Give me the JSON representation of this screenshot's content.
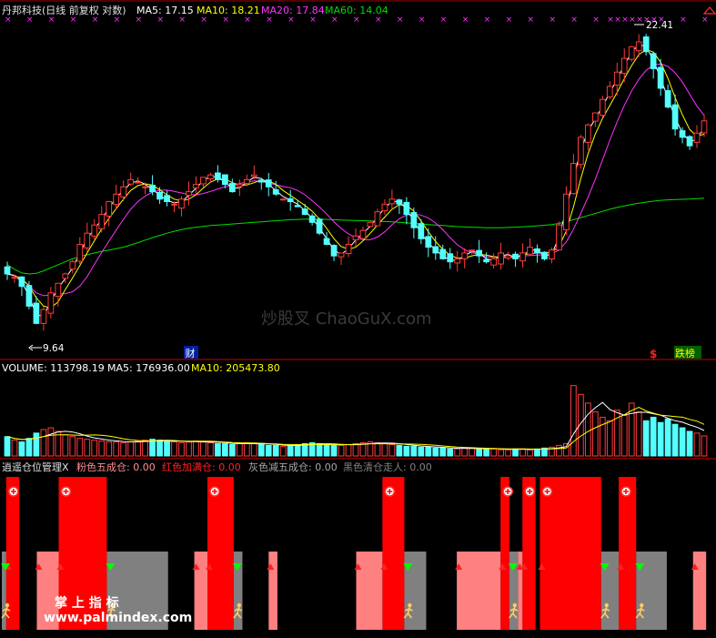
{
  "header": {
    "stock_title": "丹邦科技(日线 前复权 对数)",
    "ma5_label": "MA5: 17.15",
    "ma10_label": "MA10: 18.21",
    "ma20_label": "MA20: 17.84",
    "ma60_label": "MA60: 14.04"
  },
  "price_panel": {
    "high_marker": "22.41",
    "low_marker": "9.64",
    "cai_badge": "财",
    "dollar_badge": "$",
    "dieban_badge": "跌榜",
    "watermark": "炒股叉 ChaoGuX.com"
  },
  "volume_header": {
    "volume_label": "VOLUME: 113798.19",
    "ma5_label": "MA5: 176936.00",
    "ma10_label": "MA10: 205473.80"
  },
  "indicator_header": {
    "name": "逍遥仓位管理X",
    "pink": "粉色五成仓: 0.00",
    "red": "红色加满仓: 0.00",
    "gray": "灰色减五成仓: 0.00",
    "black": "黑色清仓走人: 0.00"
  },
  "footer": {
    "brand_cn": "掌 上 指 标",
    "brand_url": "www.palmindex.com"
  },
  "colors": {
    "up": "#ff3b3b",
    "down": "#54ffff",
    "ma5": "#ffffff",
    "ma10": "#ffff00",
    "ma20": "#ff33ff",
    "ma60": "#00dd00",
    "red_band": "#ff0000",
    "pink_band": "#ff8080",
    "gray_band": "#808080"
  },
  "chart_data": {
    "type": "candlestick",
    "price_scale": "log",
    "ylim": [
      9.2,
      23.6
    ],
    "highest": 22.41,
    "lowest": 9.64,
    "closes": [
      11.6,
      11.5,
      11.2,
      10.6,
      10.1,
      10.5,
      11.0,
      11.3,
      11.6,
      12.0,
      12.6,
      13.0,
      13.3,
      13.7,
      14.2,
      14.5,
      14.8,
      15.1,
      15.0,
      14.8,
      14.6,
      14.3,
      14.2,
      14.1,
      14.3,
      14.6,
      14.9,
      15.2,
      15.3,
      15.1,
      14.9,
      14.6,
      14.9,
      15.1,
      15.3,
      15.0,
      14.8,
      14.5,
      14.3,
      14.2,
      14.0,
      13.7,
      13.4,
      13.0,
      12.6,
      12.2,
      12.3,
      12.6,
      12.9,
      13.1,
      13.4,
      13.8,
      14.1,
      14.3,
      14.1,
      13.7,
      13.2,
      12.8,
      12.5,
      12.3,
      12.1,
      12.0,
      12.1,
      12.3,
      12.4,
      12.2,
      12.0,
      12.1,
      12.3,
      12.2,
      12.1,
      12.3,
      12.5,
      12.3,
      12.1,
      12.4,
      13.3,
      14.5,
      15.8,
      17.0,
      17.6,
      18.2,
      18.9,
      19.6,
      20.4,
      21.2,
      21.9,
      22.2,
      21.6,
      20.6,
      19.5,
      18.5,
      17.4,
      17.0,
      16.6,
      17.2,
      17.8
    ],
    "ma60": [
      11.9,
      11.75,
      11.63,
      11.6,
      11.62,
      11.7,
      11.8,
      11.9,
      12.0,
      12.1,
      12.18,
      12.24,
      12.3,
      12.35,
      12.4,
      12.45,
      12.5,
      12.58,
      12.66,
      12.75,
      12.84,
      12.92,
      13.0,
      13.07,
      13.13,
      13.18,
      13.22,
      13.25,
      13.28,
      13.3,
      13.32,
      13.34,
      13.36,
      13.38,
      13.4,
      13.42,
      13.44,
      13.46,
      13.48,
      13.5,
      13.51,
      13.52,
      13.52,
      13.52,
      13.51,
      13.5,
      13.49,
      13.48,
      13.47,
      13.46,
      13.45,
      13.44,
      13.43,
      13.42,
      13.4,
      13.38,
      13.36,
      13.34,
      13.32,
      13.3,
      13.28,
      13.26,
      13.24,
      13.23,
      13.22,
      13.21,
      13.2,
      13.2,
      13.2,
      13.21,
      13.22,
      13.23,
      13.25,
      13.27,
      13.29,
      13.32,
      13.36,
      13.42,
      13.5,
      13.58,
      13.66,
      13.74,
      13.82,
      13.9,
      13.97,
      14.03,
      14.09,
      14.14,
      14.18,
      14.22,
      14.25,
      14.27,
      14.28,
      14.29,
      14.3,
      14.32,
      14.34
    ],
    "volume_ylim": [
      0,
      460000
    ],
    "volumes": [
      110,
      90,
      80,
      100,
      130,
      150,
      160,
      140,
      120,
      110,
      100,
      95,
      90,
      85,
      80,
      80,
      75,
      80,
      85,
      90,
      95,
      90,
      85,
      80,
      75,
      80,
      85,
      80,
      75,
      70,
      70,
      65,
      70,
      75,
      70,
      65,
      60,
      60,
      55,
      60,
      65,
      70,
      75,
      70,
      65,
      60,
      60,
      65,
      70,
      75,
      80,
      75,
      70,
      65,
      60,
      55,
      55,
      50,
      50,
      45,
      45,
      40,
      40,
      45,
      45,
      40,
      40,
      40,
      35,
      35,
      40,
      40,
      35,
      40,
      45,
      50,
      60,
      70,
      400,
      350,
      300,
      250,
      220,
      200,
      260,
      230,
      300,
      250,
      200,
      220,
      190,
      210,
      180,
      160,
      140,
      130,
      114
    ],
    "volume_unit": "x1000",
    "indicator_bands": [
      {
        "color": "red",
        "from": 1,
        "to": 4
      },
      {
        "color": "red",
        "from": 13,
        "to": 24
      },
      {
        "color": "red",
        "from": 47,
        "to": 53
      },
      {
        "color": "red",
        "from": 87,
        "to": 92
      },
      {
        "color": "red",
        "from": 114,
        "to": 116
      },
      {
        "color": "red",
        "from": 119,
        "to": 122
      },
      {
        "color": "red",
        "from": 123,
        "to": 137
      },
      {
        "color": "red",
        "from": 141,
        "to": 145
      },
      {
        "color": "pink",
        "from": 8,
        "to": 13
      },
      {
        "color": "pink",
        "from": 44,
        "to": 47
      },
      {
        "color": "pink",
        "from": 61,
        "to": 63
      },
      {
        "color": "pink",
        "from": 81,
        "to": 87
      },
      {
        "color": "pink",
        "from": 104,
        "to": 114
      },
      {
        "color": "pink",
        "from": 118,
        "to": 119
      },
      {
        "color": "pink",
        "from": 158,
        "to": 161
      },
      {
        "color": "gray",
        "from": 0,
        "to": 1
      },
      {
        "color": "gray",
        "from": 24,
        "to": 38
      },
      {
        "color": "gray",
        "from": 53,
        "to": 55
      },
      {
        "color": "gray",
        "from": 92,
        "to": 97
      },
      {
        "color": "gray",
        "from": 116,
        "to": 118
      },
      {
        "color": "gray",
        "from": 137,
        "to": 141
      },
      {
        "color": "gray",
        "from": 145,
        "to": 152
      }
    ],
    "total_bars": 162
  }
}
